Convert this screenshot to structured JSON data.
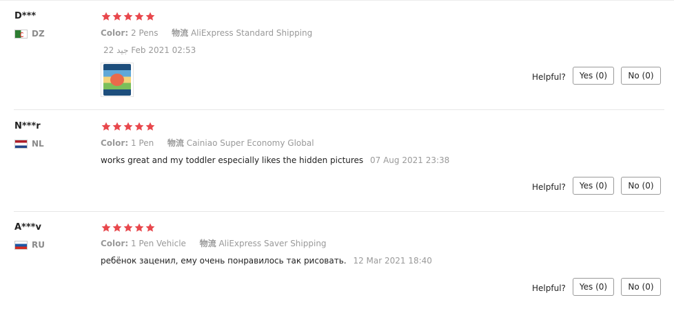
{
  "reviews": [
    {
      "user": "D***",
      "country": "DZ",
      "rating": 5,
      "color_label": "Color:",
      "color_value": "2 Pens",
      "shipping_label": "物流",
      "shipping_value": "AliExpress Standard Shipping",
      "date": "22 جيد Feb 2021 02:53",
      "text": "",
      "has_image": true,
      "helpful_label": "Helpful?",
      "yes_label": "Yes (0)",
      "no_label": "No (0)"
    },
    {
      "user": "N***r",
      "country": "NL",
      "rating": 5,
      "color_label": "Color:",
      "color_value": "1 Pen",
      "shipping_label": "物流",
      "shipping_value": "Cainiao Super Economy Global",
      "date": "07 Aug 2021 23:38",
      "text": "works great and my toddler especially likes the hidden pictures",
      "has_image": false,
      "helpful_label": "Helpful?",
      "yes_label": "Yes (0)",
      "no_label": "No (0)"
    },
    {
      "user": "A***v",
      "country": "RU",
      "rating": 5,
      "color_label": "Color:",
      "color_value": "1 Pen Vehicle",
      "shipping_label": "物流",
      "shipping_value": "AliExpress Saver Shipping",
      "date": "12 Mar 2021 18:40",
      "text": "ребёнок заценил, ему очень понравилось так рисовать.",
      "has_image": false,
      "helpful_label": "Helpful?",
      "yes_label": "Yes (0)",
      "no_label": "No (0)"
    }
  ],
  "colors": {
    "star": "#e8474c",
    "muted_text": "#999999",
    "body_text": "#222222",
    "button_border": "#999999"
  },
  "icons": {
    "star": "star-icon",
    "flag_dz": "algeria-flag-icon",
    "flag_nl": "netherlands-flag-icon",
    "flag_ru": "russia-flag-icon"
  }
}
